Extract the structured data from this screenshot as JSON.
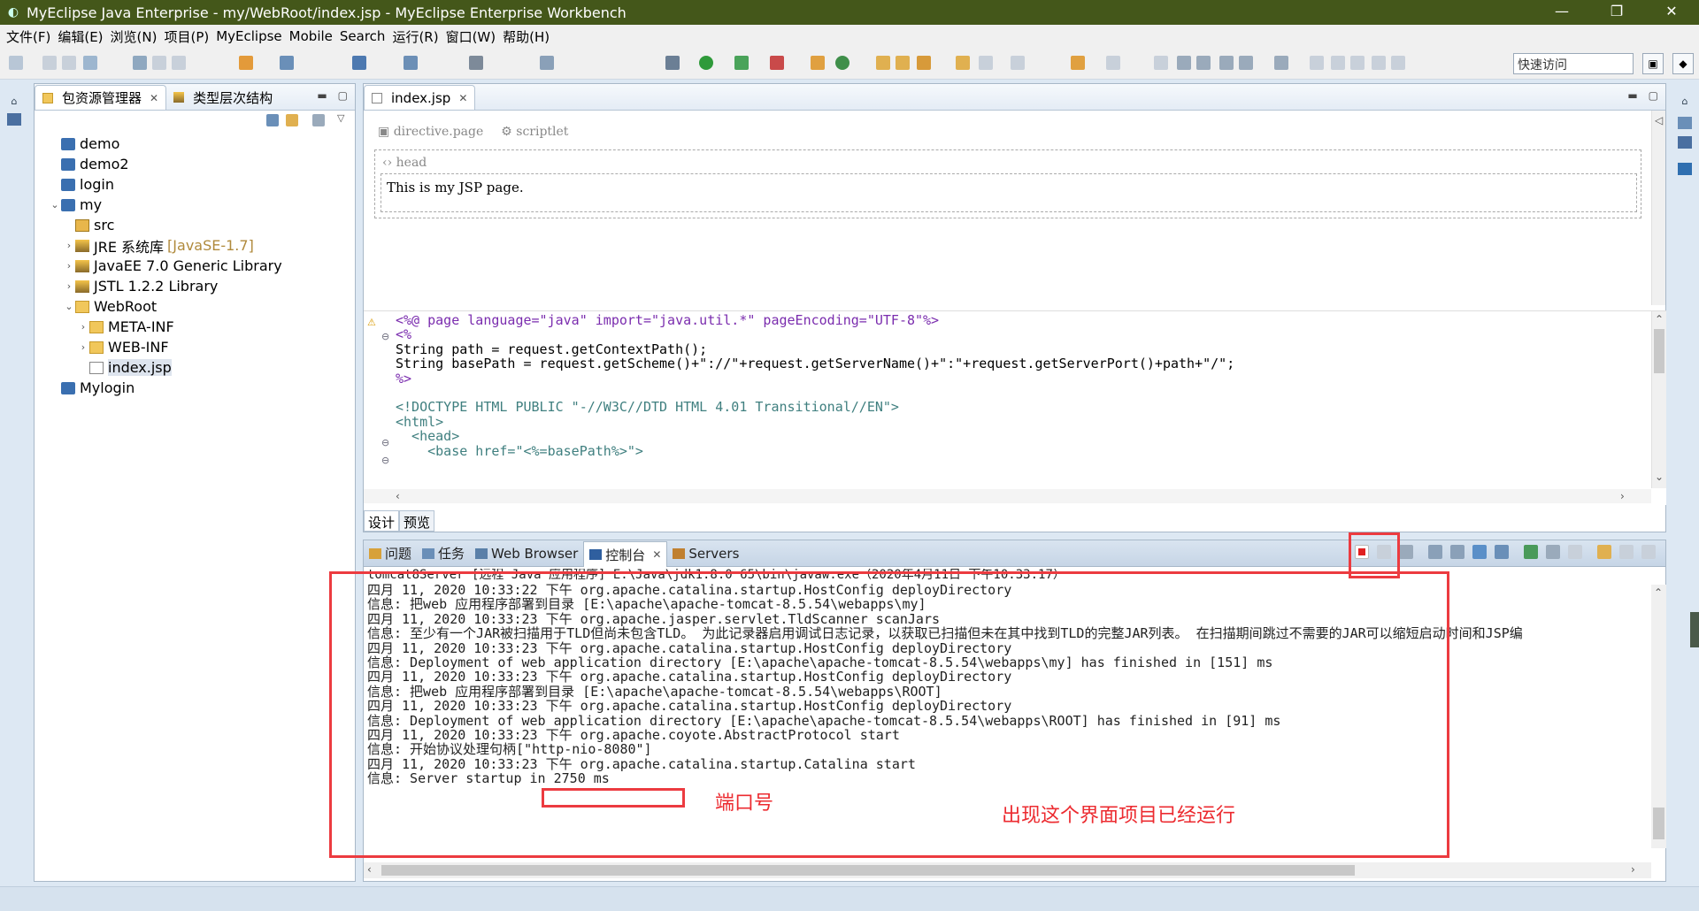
{
  "window": {
    "title": "MyEclipse Java Enterprise - my/WebRoot/index.jsp - MyEclipse Enterprise Workbench",
    "controls": [
      "—",
      "❐",
      "✕"
    ]
  },
  "menu": [
    "文件(F)",
    "编辑(E)",
    "浏览(N)",
    "项目(P)",
    "MyEclipse",
    "Mobile",
    "Search",
    "运行(R)",
    "窗口(W)",
    "帮助(H)"
  ],
  "toolbar": {
    "quick_access": "快速访问"
  },
  "explorer": {
    "tabs": [
      {
        "label": "包资源管理器",
        "icon": "package-icon",
        "active": true
      },
      {
        "label": "类型层次结构",
        "icon": "hierarchy-icon",
        "active": false
      }
    ],
    "tree": [
      {
        "label": "demo",
        "level": 0,
        "type": "project",
        "twist": ""
      },
      {
        "label": "demo2",
        "level": 0,
        "type": "project",
        "twist": ""
      },
      {
        "label": "login",
        "level": 0,
        "type": "project",
        "twist": ""
      },
      {
        "label": "my",
        "level": 0,
        "type": "project",
        "twist": "v"
      },
      {
        "label": "src",
        "level": 1,
        "type": "src",
        "twist": ""
      },
      {
        "label": "JRE 系统库",
        "decor": "[JavaSE-1.7]",
        "level": 1,
        "type": "jar",
        "twist": ">"
      },
      {
        "label": "JavaEE 7.0 Generic Library",
        "level": 1,
        "type": "jar",
        "twist": ">"
      },
      {
        "label": "JSTL 1.2.2 Library",
        "level": 1,
        "type": "jar",
        "twist": ">"
      },
      {
        "label": "WebRoot",
        "level": 1,
        "type": "folder",
        "twist": "v"
      },
      {
        "label": "META-INF",
        "level": 2,
        "type": "folder",
        "twist": ">"
      },
      {
        "label": "WEB-INF",
        "level": 2,
        "type": "folder",
        "twist": ">"
      },
      {
        "label": "index.jsp",
        "level": 2,
        "type": "jsp",
        "twist": "",
        "selected": true
      },
      {
        "label": "Mylogin",
        "level": 0,
        "type": "project",
        "twist": ""
      }
    ]
  },
  "editor": {
    "tab_label": "index.jsp",
    "design": {
      "directive_label": "directive.page",
      "scriptlet_label": "scriptlet",
      "head_label": "head",
      "body_text": "This is my JSP page."
    },
    "code_lines": [
      "<%@ page language=\"java\" import=\"java.util.*\" pageEncoding=\"UTF-8\"%>",
      "<%",
      "String path = request.getContextPath();",
      "String basePath = request.getScheme()+\"://\"+request.getServerName()+\":\"+request.getServerPort()+path+\"/\";",
      "%>",
      "",
      "<!DOCTYPE HTML PUBLIC \"-//W3C//DTD HTML 4.01 Transitional//EN\">",
      "<html>",
      "  <head>",
      "    <base href=\"<%=basePath%>\">"
    ],
    "bottom_tabs": [
      "设计",
      "预览"
    ]
  },
  "console": {
    "tabs": [
      {
        "label": "问题",
        "active": false
      },
      {
        "label": "任务",
        "active": false
      },
      {
        "label": "Web Browser",
        "active": false
      },
      {
        "label": "控制台",
        "active": true
      },
      {
        "label": "Servers",
        "active": false
      }
    ],
    "header": "tomcat8Server [远程 Java 应用程序] E:\\Java\\jdk1.8.0_65\\bin\\javaw.exe（2020年4月11日 下午10:33:17）",
    "lines": [
      "四月 11, 2020 10:33:22 下午 org.apache.catalina.startup.HostConfig deployDirectory",
      "信息: 把web 应用程序部署到目录 [E:\\apache\\apache-tomcat-8.5.54\\webapps\\my]",
      "四月 11, 2020 10:33:23 下午 org.apache.jasper.servlet.TldScanner scanJars",
      "信息: 至少有一个JAR被扫描用于TLD但尚未包含TLD。 为此记录器启用调试日志记录，以获取已扫描但未在其中找到TLD的完整JAR列表。 在扫描期间跳过不需要的JAR可以缩短启动时间和JSP编",
      "四月 11, 2020 10:33:23 下午 org.apache.catalina.startup.HostConfig deployDirectory",
      "信息: Deployment of web application directory [E:\\apache\\apache-tomcat-8.5.54\\webapps\\my] has finished in [151] ms",
      "四月 11, 2020 10:33:23 下午 org.apache.catalina.startup.HostConfig deployDirectory",
      "信息: 把web 应用程序部署到目录 [E:\\apache\\apache-tomcat-8.5.54\\webapps\\ROOT]",
      "四月 11, 2020 10:33:23 下午 org.apache.catalina.startup.HostConfig deployDirectory",
      "信息: Deployment of web application directory [E:\\apache\\apache-tomcat-8.5.54\\webapps\\ROOT] has finished in [91] ms",
      "四月 11, 2020 10:33:23 下午 org.apache.coyote.AbstractProtocol start",
      "信息: 开始协议处理句柄[\"http-nio-8080\"]",
      "四月 11, 2020 10:33:23 下午 org.apache.catalina.startup.Catalina start",
      "信息: Server startup in 2750 ms"
    ]
  },
  "annotations": {
    "port_label": "端口号",
    "running_label": "出现这个界面项目已经运行",
    "color": "#ec3b40"
  }
}
